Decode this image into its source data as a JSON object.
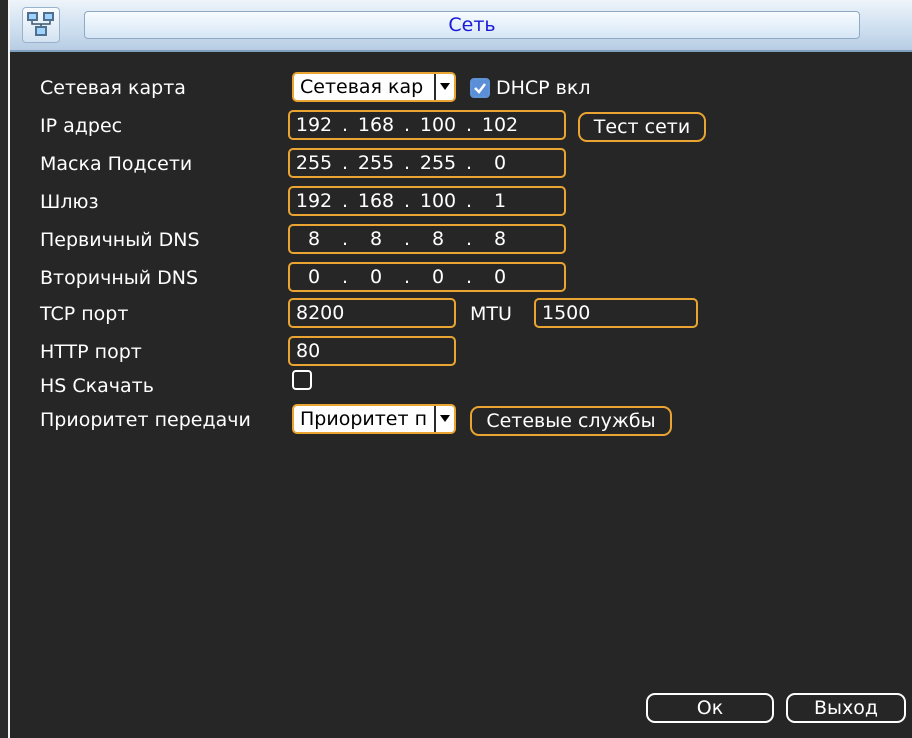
{
  "window": {
    "title": "Сеть"
  },
  "rows": {
    "network_card": {
      "label": "Сетевая карта",
      "value": "Сетевая кар"
    },
    "dhcp": {
      "label": "DHCP вкл",
      "checked": true
    },
    "ip": {
      "label": "IP адрес",
      "octets": [
        "192",
        "168",
        "100",
        "102"
      ]
    },
    "test_button": "Тест сети",
    "mask": {
      "label": "Маска Подсети",
      "octets": [
        "255",
        "255",
        "255",
        "0"
      ]
    },
    "gateway": {
      "label": "Шлюз",
      "octets": [
        "192",
        "168",
        "100",
        "1"
      ]
    },
    "dns1": {
      "label": "Первичный DNS",
      "octets": [
        "8",
        "8",
        "8",
        "8"
      ]
    },
    "dns2": {
      "label": "Вторичный DNS",
      "octets": [
        "0",
        "0",
        "0",
        "0"
      ]
    },
    "tcp": {
      "label": "TCP порт",
      "value": "8200"
    },
    "mtu": {
      "label": "MTU",
      "value": "1500"
    },
    "http": {
      "label": "HTTP порт",
      "value": "80"
    },
    "hs": {
      "label": "HS Скачать",
      "checked": false
    },
    "priority": {
      "label": "Приоритет передачи",
      "value": "Приоритет п"
    },
    "services_button": "Сетевые службы"
  },
  "footer": {
    "ok": "Ок",
    "exit": "Выход"
  },
  "icons": [
    "network-icon",
    "dropdown-arrow-icon",
    "check-icon"
  ],
  "colors": {
    "field_border": "#e9a431",
    "checkbox": "#5a8fd8",
    "title_text": "#1a1ad8"
  }
}
